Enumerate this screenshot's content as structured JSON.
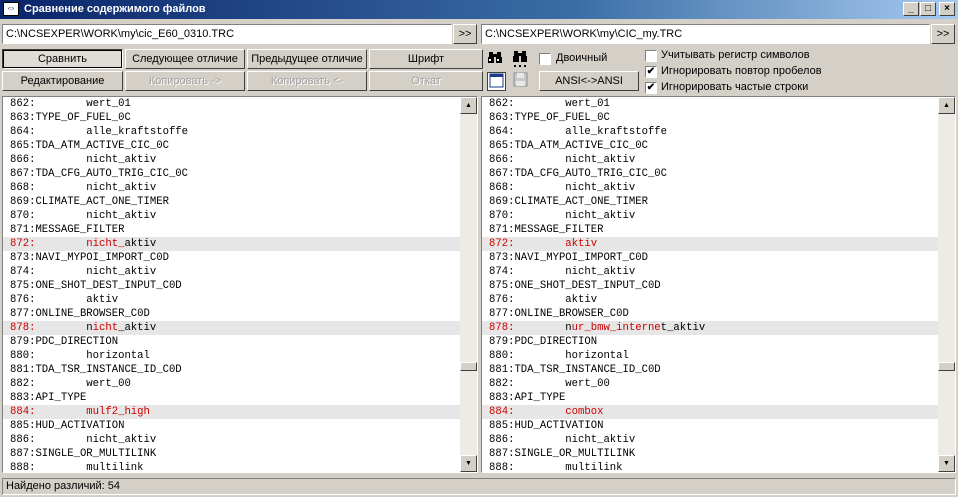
{
  "window": {
    "title": "Сравнение содержимого файлов",
    "minimize": "_",
    "maximize": "□",
    "close": "×"
  },
  "left_path": "C:\\NCSEXPER\\WORK\\my\\cic_E60_0310.TRC",
  "right_path": "C:\\NCSEXPER\\WORK\\my\\CIC_my.TRC",
  "browse_label": ">>",
  "toolbar": {
    "compare": "Сравнить",
    "next_diff": "Следующее отличие",
    "prev_diff": "Предыдущее отличие",
    "font": "Шрифт",
    "edit": "Редактирование",
    "copy_right": "Копировать ->",
    "copy_left": "Копировать <-",
    "rollback": "Откат",
    "ansi": "ANSI<->ANSI",
    "binary": "Двоичный"
  },
  "options": {
    "case_sensitive": "Учитывать регистр символов",
    "ignore_spaces": "Игнорировать повтор пробелов",
    "ignore_frequent": "Игнорировать частые строки",
    "check_mark": "✔"
  },
  "left_lines": [
    {
      "num": "862:",
      "text": "        wert_01",
      "diff": false
    },
    {
      "num": "863:",
      "text": "TYPE_OF_FUEL_0C",
      "diff": false
    },
    {
      "num": "864:",
      "text": "        alle_kraftstoffe",
      "diff": false
    },
    {
      "num": "865:",
      "text": "TDA_ATM_ACTIVE_CIC_0C",
      "diff": false
    },
    {
      "num": "866:",
      "text": "        nicht_aktiv",
      "diff": false
    },
    {
      "num": "867:",
      "text": "TDA_CFG_AUTO_TRIG_CIC_0C",
      "diff": false
    },
    {
      "num": "868:",
      "text": "        nicht_aktiv",
      "diff": false
    },
    {
      "num": "869:",
      "text": "CLIMATE_ACT_ONE_TIMER",
      "diff": false
    },
    {
      "num": "870:",
      "text": "        nicht_aktiv",
      "diff": false
    },
    {
      "num": "871:",
      "text": "MESSAGE_FILTER",
      "diff": false
    },
    {
      "num": "872:",
      "text": "        ",
      "hl": "nicht_",
      "rest": "aktiv",
      "diff": true
    },
    {
      "num": "873:",
      "text": "NAVI_MYPOI_IMPORT_C0D",
      "diff": false
    },
    {
      "num": "874:",
      "text": "        nicht_aktiv",
      "diff": false
    },
    {
      "num": "875:",
      "text": "ONE_SHOT_DEST_INPUT_C0D",
      "diff": false
    },
    {
      "num": "876:",
      "text": "        aktiv",
      "diff": false
    },
    {
      "num": "877:",
      "text": "ONLINE_BROWSER_C0D",
      "diff": false
    },
    {
      "num": "878:",
      "text": "        n",
      "hl": "icht",
      "rest": "_aktiv",
      "diff": true
    },
    {
      "num": "879:",
      "text": "PDC_DIRECTION",
      "diff": false
    },
    {
      "num": "880:",
      "text": "        horizontal",
      "diff": false
    },
    {
      "num": "881:",
      "text": "TDA_TSR_INSTANCE_ID_C0D",
      "diff": false
    },
    {
      "num": "882:",
      "text": "        wert_00",
      "diff": false
    },
    {
      "num": "883:",
      "text": "API_TYPE",
      "diff": false
    },
    {
      "num": "884:",
      "text": "        ",
      "hl": "mulf2_high",
      "rest": "",
      "diff": true
    },
    {
      "num": "885:",
      "text": "HUD_ACTIVATION",
      "diff": false
    },
    {
      "num": "886:",
      "text": "        nicht_aktiv",
      "diff": false
    },
    {
      "num": "887:",
      "text": "SINGLE_OR_MULTILINK",
      "diff": false
    },
    {
      "num": "888:",
      "text": "        multilink",
      "diff": false
    }
  ],
  "right_lines": [
    {
      "num": "862:",
      "text": "        wert_01",
      "diff": false
    },
    {
      "num": "863:",
      "text": "TYPE_OF_FUEL_0C",
      "diff": false
    },
    {
      "num": "864:",
      "text": "        alle_kraftstoffe",
      "diff": false
    },
    {
      "num": "865:",
      "text": "TDA_ATM_ACTIVE_CIC_0C",
      "diff": false
    },
    {
      "num": "866:",
      "text": "        nicht_aktiv",
      "diff": false
    },
    {
      "num": "867:",
      "text": "TDA_CFG_AUTO_TRIG_CIC_0C",
      "diff": false
    },
    {
      "num": "868:",
      "text": "        nicht_aktiv",
      "diff": false
    },
    {
      "num": "869:",
      "text": "CLIMATE_ACT_ONE_TIMER",
      "diff": false
    },
    {
      "num": "870:",
      "text": "        nicht_aktiv",
      "diff": false
    },
    {
      "num": "871:",
      "text": "MESSAGE_FILTER",
      "diff": false
    },
    {
      "num": "872:",
      "text": "        aktiv",
      "diff": true
    },
    {
      "num": "873:",
      "text": "NAVI_MYPOI_IMPORT_C0D",
      "diff": false
    },
    {
      "num": "874:",
      "text": "        nicht_aktiv",
      "diff": false
    },
    {
      "num": "875:",
      "text": "ONE_SHOT_DEST_INPUT_C0D",
      "diff": false
    },
    {
      "num": "876:",
      "text": "        aktiv",
      "diff": false
    },
    {
      "num": "877:",
      "text": "ONLINE_BROWSER_C0D",
      "diff": false
    },
    {
      "num": "878:",
      "text": "        n",
      "hl": "ur_bmw_interne",
      "rest": "t_aktiv",
      "diff": true
    },
    {
      "num": "879:",
      "text": "PDC_DIRECTION",
      "diff": false
    },
    {
      "num": "880:",
      "text": "        horizontal",
      "diff": false
    },
    {
      "num": "881:",
      "text": "TDA_TSR_INSTANCE_ID_C0D",
      "diff": false
    },
    {
      "num": "882:",
      "text": "        wert_00",
      "diff": false
    },
    {
      "num": "883:",
      "text": "API_TYPE",
      "diff": false
    },
    {
      "num": "884:",
      "text": "        ",
      "hl": "combox",
      "rest": "",
      "diff": true
    },
    {
      "num": "885:",
      "text": "HUD_ACTIVATION",
      "diff": false
    },
    {
      "num": "886:",
      "text": "        nicht_aktiv",
      "diff": false
    },
    {
      "num": "887:",
      "text": "SINGLE_OR_MULTILINK",
      "diff": false
    },
    {
      "num": "888:",
      "text": "        multilink",
      "diff": false
    }
  ],
  "status": {
    "differences": "Найдено различий: 54"
  },
  "icons": {
    "find": "binoculars-icon",
    "find_next": "binoculars-next-icon",
    "window": "window-icon",
    "save": "floppy-disk-icon",
    "scroll_up": "▲",
    "scroll_down": "▼"
  }
}
